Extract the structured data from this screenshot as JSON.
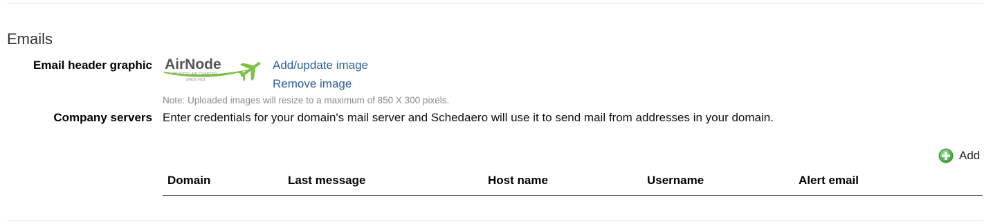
{
  "section": {
    "title": "Emails"
  },
  "email_header": {
    "label": "Email header graphic",
    "logo": {
      "name": "AirNode",
      "tagline": "TRUSTED AIR CHARTER",
      "since": "SINCE 2001"
    },
    "add_update_link": "Add/update image",
    "remove_link": "Remove image",
    "note": "Note: Uploaded images will resize to a maximum of 850 X 300 pixels."
  },
  "company_servers": {
    "label": "Company servers",
    "description": "Enter credentials for your domain's mail server and Schedaero will use it to send mail from addresses in your domain.",
    "add_label": "Add",
    "add_icon": "plus-circle-icon",
    "columns": [
      "Domain",
      "Last message",
      "Host name",
      "Username",
      "Alert email"
    ],
    "rows": []
  },
  "colors": {
    "link": "#2d5f99",
    "note": "#8a8a8a",
    "add_icon_green": "#5cb85c",
    "logo_green": "#7dc142"
  }
}
